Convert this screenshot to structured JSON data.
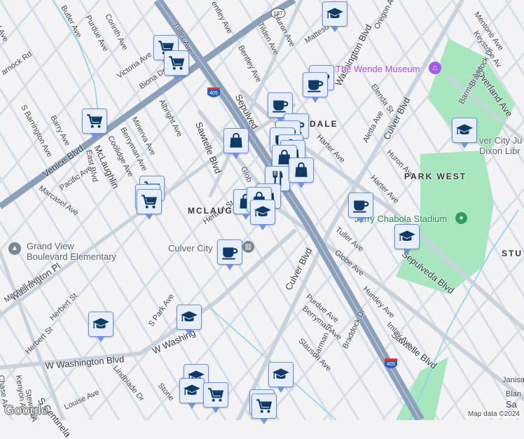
{
  "map": {
    "attribution": "Map data ©2024",
    "logo": "Google",
    "colors": {
      "marker_bg": "#e6eefc",
      "marker_border": "#6f94dc",
      "icon": "#0d3b66",
      "freeway": "#8aa0bb",
      "park": "#a8e6bf",
      "water": "#7fd6ea",
      "poi_purple": "#9b4fe0"
    },
    "highway_shields": [
      "405",
      "187"
    ],
    "areas": [
      "MCLAUGHLIN",
      "DALE",
      "PARK WEST",
      "STU"
    ],
    "pois": {
      "wende": "The Wende Museum",
      "stadium": "Jerry Chabola Stadium",
      "library": "Culver City Julian Dixon Library",
      "library_l1": "ver City Ju",
      "library_l2": "Dixon Libr",
      "school_l1": "Grand View",
      "school_l2": "Boulevard Elementary",
      "culver_city": "Culver City"
    },
    "streets": {
      "venice": "Venice Blvd.",
      "sepulveda": "Sepulveda Blvd",
      "sepulveda_top": "Sepulved",
      "sawtelle": "Sawtelle Blvd",
      "sawtelle2": "Sawtelle Blvd",
      "culver": "Culver Blvd",
      "culver2": "Culver Blvd",
      "washington": "Washington Blvd",
      "w_washington": "W Washington Blvd",
      "w_washing2": "W Washing",
      "washington_pl": "Washington Pl",
      "overland": "Overland Ave",
      "mclaughlin": "McLaughlin",
      "butler": "Butler Ave",
      "purdue": "Purdue Ave",
      "corinth": "Corinth Ave",
      "victoria": "Victoria Ave",
      "biona": "Biona Dr",
      "tuller": "Tuller Ave",
      "bentley": "Bentley Ave",
      "bentley2": "entley Ave",
      "albright": "Albright Ave",
      "minerva": "Minerva Ave",
      "berryman": "Berryman Ave",
      "coolidge": "Coolidge Ave",
      "east": "East Blvd",
      "pacific": "Pacific Ave",
      "marcasel": "Marcasel Ave",
      "barry": "Barry Ave",
      "barrington": "S Barrington Ave",
      "carmock": "arnock Rd",
      "huron": "Huron Ave",
      "tilden": "Tilden Ave",
      "matteson": "Matteso",
      "oregon": "Oregon Ave",
      "mentone": "Mentone Ave",
      "keystone": "Keystone Av",
      "elenda": "Elenda St",
      "aletta": "Aletta Ave",
      "harter": "Harter Ave",
      "harter2": "Harter Ave",
      "huron2": "Huron Ave",
      "barman": "Barman Ave",
      "braddock": "Braddock Dr",
      "herbert": "Herbert St",
      "globe": "Globe Ave",
      "tuller2": "Tuller Ave",
      "purdue2": "Purdue Ave",
      "berryman2": "Berryman Ave",
      "barman_st": "Barman St",
      "braddock2": "Braddock Dr",
      "huntley": "Huntley Ave",
      "imlay": "Imlay Ave",
      "slauson": "Slauson Ave",
      "mitchell": "Mitchell Ave",
      "s_park": "S Park Ave",
      "herbert2": "Herbert St",
      "herbert3": "Herbert St",
      "lindblade": "Lindblade Dr",
      "louise": "Louise Ave",
      "centinela": "S Centinela",
      "stone": "Stone",
      "chase": "Chase Av",
      "kenyon": "Kenyon Av",
      "stewart": "Stewart A",
      "janisa": "Janisa",
      "blan": "Blan",
      "sa": "Sa",
      "glob": "Glob",
      "al": "al Ave"
    },
    "markers": [
      "cart",
      "cart",
      "cart",
      "bag",
      "grad",
      "coffee",
      "coffee",
      "coffee",
      "coffee",
      "coffee",
      "coffee",
      "bag",
      "bag",
      "bag",
      "fork",
      "bag",
      "bag",
      "cart",
      "cart",
      "cart",
      "bag",
      "bag",
      "grad",
      "coffee",
      "grad",
      "grad",
      "coffee",
      "grad",
      "grad",
      "grad",
      "grad",
      "grad",
      "cart",
      "cart",
      "cart"
    ]
  }
}
